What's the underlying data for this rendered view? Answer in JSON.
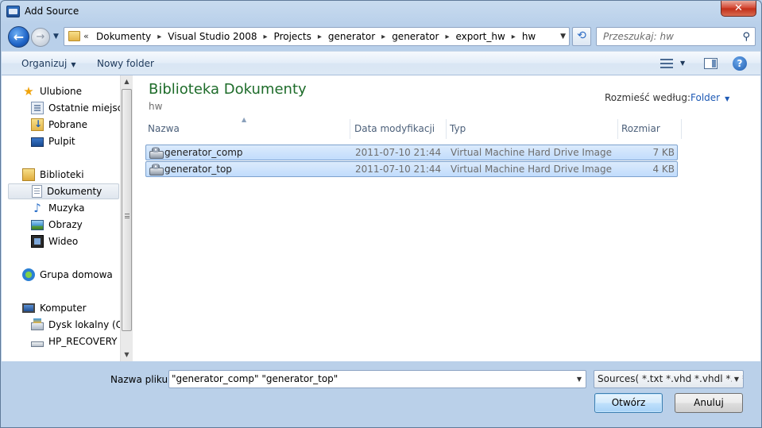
{
  "window": {
    "title": "Add Source",
    "close_glyph": "✕"
  },
  "nav": {
    "back_glyph": "←",
    "forward_glyph": "→",
    "breadcrumb_prefix": "«",
    "breadcrumbs": [
      "Dokumenty",
      "Visual Studio 2008",
      "Projects",
      "generator",
      "generator",
      "export_hw",
      "hw"
    ],
    "search_placeholder": "Przeszukaj: hw"
  },
  "toolbar": {
    "organize_label": "Organizuj",
    "new_folder_label": "Nowy folder",
    "help_glyph": "?"
  },
  "sidebar": {
    "items": [
      {
        "label": "Ulubione",
        "icon": "star-icon"
      },
      {
        "label": "Ostatnie miejsca",
        "icon": "recent-places-icon"
      },
      {
        "label": "Pobrane",
        "icon": "downloads-icon"
      },
      {
        "label": "Pulpit",
        "icon": "desktop-icon"
      },
      {
        "label": "Biblioteki",
        "icon": "libraries-icon"
      },
      {
        "label": "Dokumenty",
        "icon": "documents-icon",
        "selected": true
      },
      {
        "label": "Muzyka",
        "icon": "music-icon"
      },
      {
        "label": "Obrazy",
        "icon": "pictures-icon"
      },
      {
        "label": "Wideo",
        "icon": "video-icon"
      },
      {
        "label": "Grupa domowa",
        "icon": "homegroup-icon"
      },
      {
        "label": "Komputer",
        "icon": "computer-icon"
      },
      {
        "label": "Dysk lokalny (C:)",
        "icon": "local-disk-icon"
      },
      {
        "label": "HP_RECOVERY (D",
        "icon": "recovery-drive-icon"
      }
    ]
  },
  "library": {
    "title": "Biblioteka Dokumenty",
    "subtitle": "hw",
    "arrange_label": "Rozmieść według:",
    "arrange_value": "Folder"
  },
  "table": {
    "columns": [
      "Nazwa",
      "Data modyfikacji",
      "Typ",
      "Rozmiar"
    ],
    "rows": [
      {
        "name": "generator_comp",
        "modified": "2011-07-10 21:44",
        "type": "Virtual Machine Hard Drive Image",
        "size": "7 KB"
      },
      {
        "name": "generator_top",
        "modified": "2011-07-10 21:44",
        "type": "Virtual Machine Hard Drive Image",
        "size": "4 KB"
      }
    ]
  },
  "footer": {
    "filename_label": "Nazwa pliku:",
    "filename_value": "\"generator_comp\" \"generator_top\"",
    "filter_value": "Sources( *.txt *.vhd *.vhdl *.v *.l",
    "open_label": "Otwórz",
    "cancel_label": "Anuluj"
  },
  "colors": {
    "accent": "#1e5ab5",
    "library_title": "#1e6c2a",
    "selection": "#c1dcfc",
    "close_button": "#c12e18"
  }
}
